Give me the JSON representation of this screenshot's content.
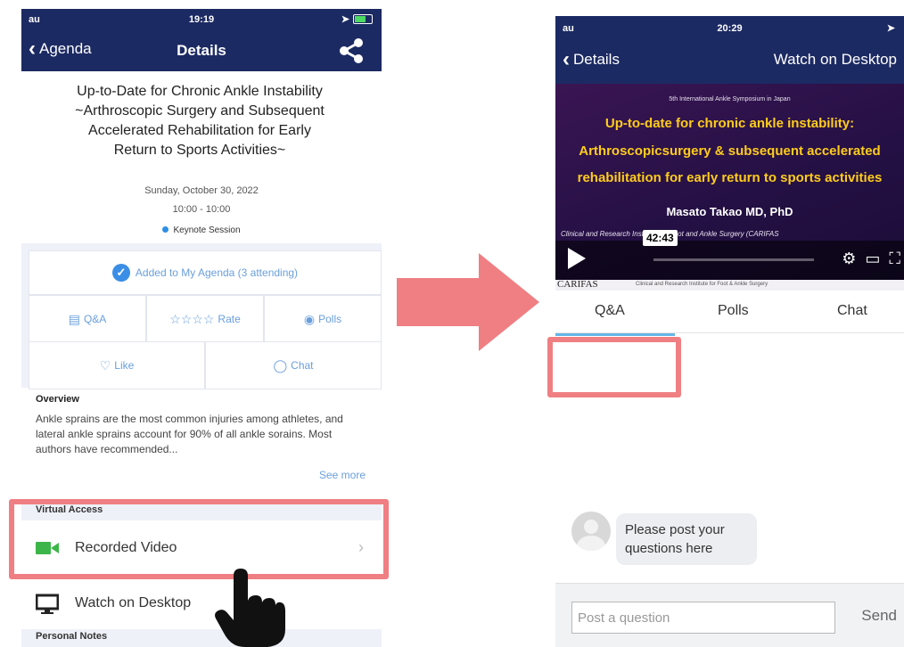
{
  "left_phone": {
    "status": {
      "carrier": "au",
      "time": "19:19"
    },
    "nav": {
      "back_label": "Agenda",
      "title": "Details"
    },
    "session": {
      "title": "Up-to-Date for Chronic Ankle Instability ~Arthroscopic Surgery and Subsequent Accelerated Rehabilitation for Early Return to Sports Activities~",
      "date": "Sunday, October 30, 2022",
      "time": "10:00 - 10:00",
      "type": "Keynote Session"
    },
    "actions": {
      "agenda": "Added to My Agenda (3 attending)",
      "qa": "Q&A",
      "rate": "Rate",
      "polls": "Polls",
      "like": "Like",
      "chat": "Chat"
    },
    "overview": {
      "heading": "Overview",
      "text": "Ankle sprains are the most common injuries among athletes, and lateral ankle sprains account for 90% of all ankle sorains. Most authors have recommended...",
      "see_more": "See more"
    },
    "virtual_access": {
      "heading": "Virtual Access",
      "recorded_video": "Recorded Video",
      "watch_desktop": "Watch on Desktop"
    },
    "personal_notes": "Personal Notes"
  },
  "right_phone": {
    "status": {
      "carrier": "au",
      "time": "20:29"
    },
    "nav": {
      "back_label": "Details",
      "action": "Watch on Desktop"
    },
    "video": {
      "symposium": "5th International Ankle Symposium in Japan",
      "line1": "Up-to-date for chronic ankle instability:",
      "line2": "Arthroscopicsurgery & subsequent accelerated",
      "line3": "rehabilitation for early return to sports activities",
      "author": "Masato Takao MD, PhD",
      "institute": "Clinical and Research Institute for Foot and Ankle Surgery (CARIFAS",
      "duration": "42:43",
      "logo": "CARIFAS",
      "footer_text": "Clinical and Research Institute for Foot & Ankle Surgery"
    },
    "tabs": {
      "qa": "Q&A",
      "polls": "Polls",
      "chat": "Chat"
    },
    "prompt": "Please post your questions here",
    "input": {
      "placeholder": "Post a question",
      "send": "Send"
    }
  },
  "colors": {
    "navbar": "#1c2a63",
    "accent_blue": "#6a9fde",
    "highlight": "#ef7f83",
    "video_title": "#ffcc1c",
    "tab_underline": "#64b5e6"
  },
  "icons": [
    "share-icon",
    "check-circle-icon",
    "qa-icon",
    "star-icon",
    "polls-icon",
    "heart-icon",
    "chat-icon",
    "video-camera-icon",
    "monitor-icon",
    "hand-pointer-icon",
    "arrow-icon",
    "play-icon",
    "gear-icon",
    "airplay-icon",
    "fullscreen-icon",
    "avatar-icon"
  ]
}
